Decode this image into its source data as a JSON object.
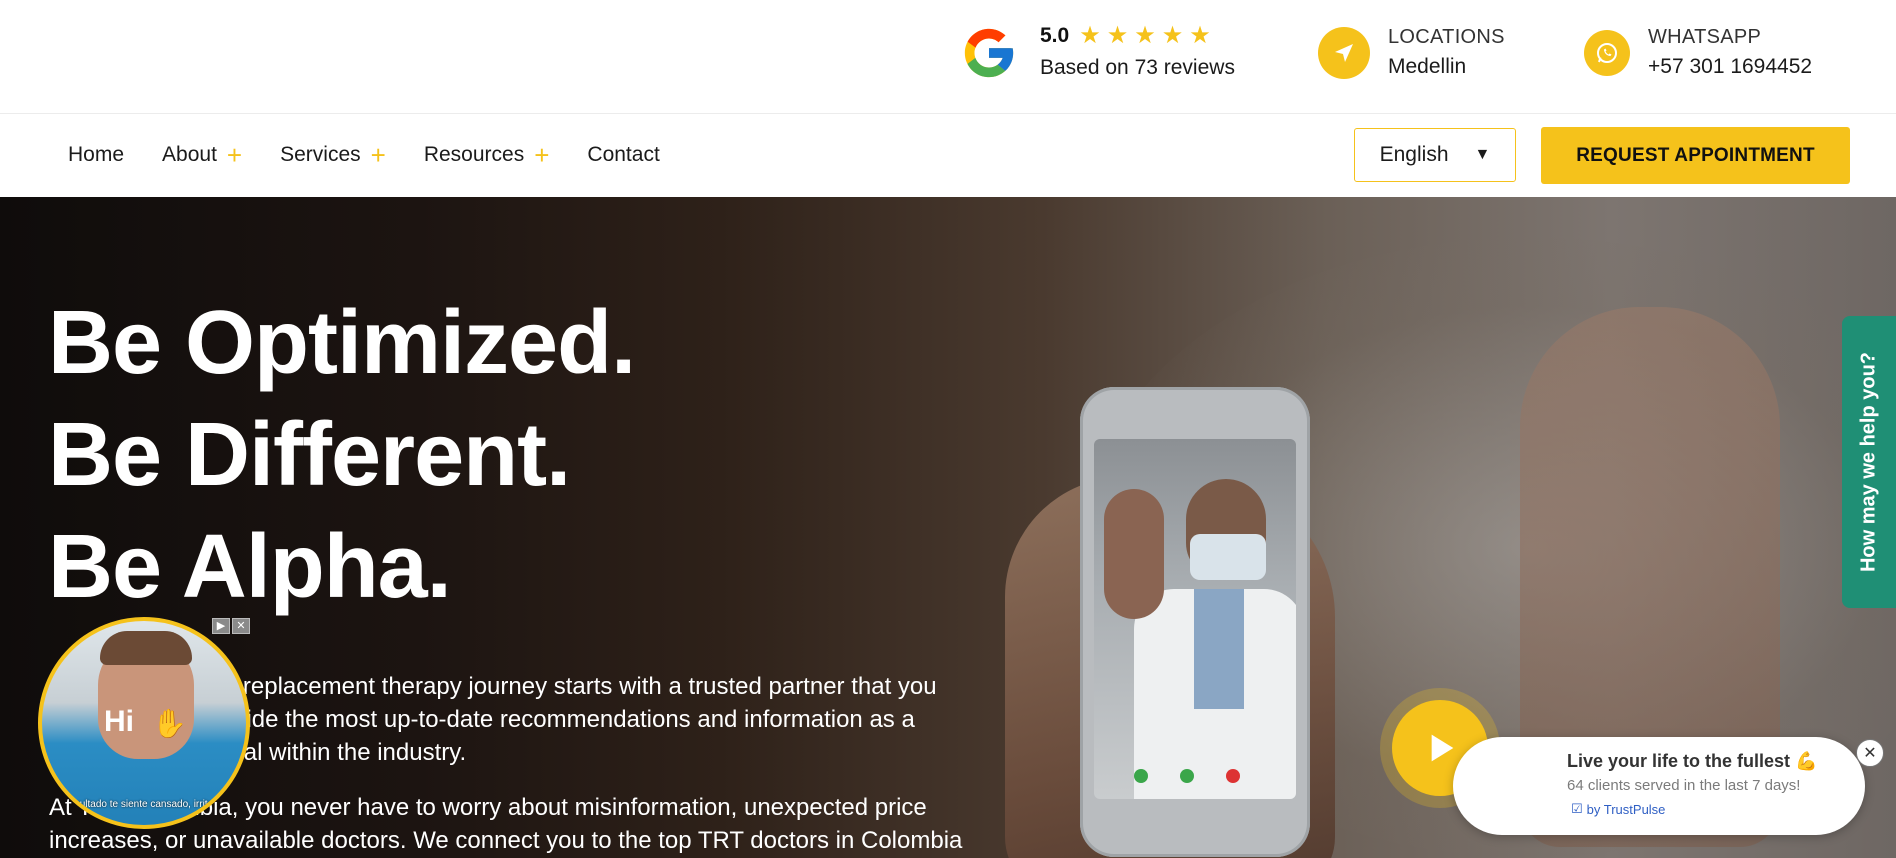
{
  "header": {
    "rating_score": "5.0",
    "star_count": 5,
    "reviews_text": "Based on 73 reviews",
    "locations_label": "LOCATIONS",
    "locations_value": "Medellin",
    "whatsapp_label": "WHATSAPP",
    "whatsapp_value": "+57 301 1694452"
  },
  "nav": {
    "items": [
      {
        "label": "Home",
        "has_submenu": false
      },
      {
        "label": "About",
        "has_submenu": true
      },
      {
        "label": "Services",
        "has_submenu": true
      },
      {
        "label": "Resources",
        "has_submenu": true
      },
      {
        "label": "Contact",
        "has_submenu": false
      }
    ],
    "language": "English",
    "cta_label": "REQUEST APPOINTMENT"
  },
  "hero": {
    "headline_1": "Be Optimized.",
    "headline_2": "Be Different.",
    "headline_3": "Be Alpha.",
    "para1_line1": "Your testosterone replacement therapy journey starts with a trusted partner that you",
    "para1_line2": "can rely on to provide the most up-to-date recommendations and information as a",
    "para1_line3": "leading professional within the industry.",
    "para2_line1": "At TRT Colombia, you never have to worry about misinformation, unexpected price",
    "para2_line2": "increases, or unavailable doctors. We connect you to the top TRT doctors in Colombia"
  },
  "help_tab": {
    "label": "How may we help you?"
  },
  "video_bubble": {
    "greeting": "Hi",
    "caption": "…sultado te siente cansado, irritable,"
  },
  "trustpulse": {
    "title": "Live your life to the fullest 💪",
    "subtitle": "64 clients served in the last 7 days!",
    "by_label": "by TrustPulse"
  },
  "colors": {
    "accent": "#f5c21b",
    "help_tab": "#1f8f75",
    "trustpulse_link": "#2f5fc4"
  },
  "icons": {
    "google": "google-g-icon",
    "location": "navigation-arrow-icon",
    "whatsapp": "whatsapp-icon",
    "play": "play-icon",
    "close": "close-icon"
  }
}
